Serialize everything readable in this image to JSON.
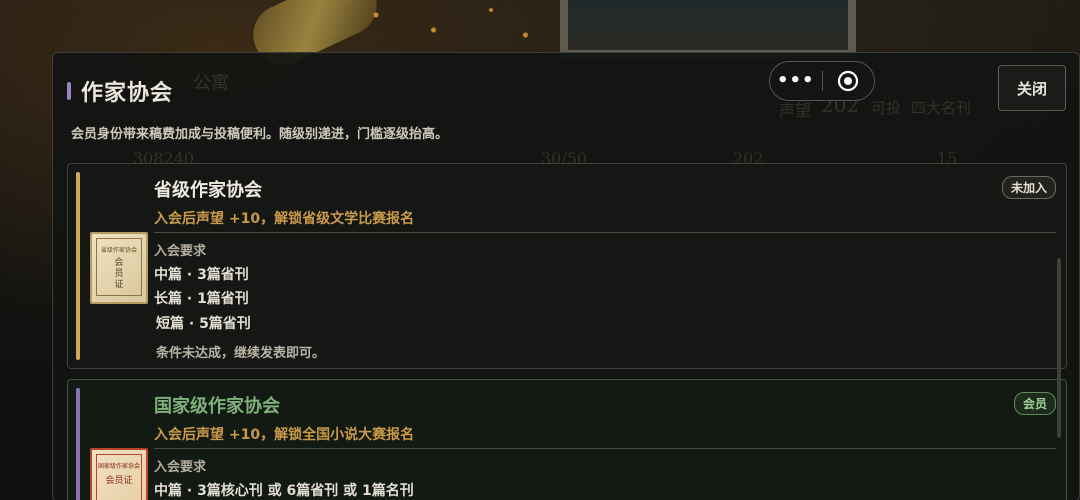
{
  "panel": {
    "title": "作家协会",
    "subtitle": "会员身份带来稿费加成与投稿便利。随级别递进，门槛逐级抬高。",
    "close_label": "关闭",
    "capsule_more": "•••"
  },
  "background_ghost": {
    "apt": "公寓",
    "reputation": "声望",
    "reputation_value": "202",
    "ghost_tag": "可投",
    "top_magazines": "四大名刊",
    "stat_a": "308240",
    "stat_b": "30/50",
    "stat_c": "202",
    "stat_d": "15"
  },
  "cards": [
    {
      "name": "省级作家协会",
      "benefit": "入会后声望 +10，解锁省级文学比赛报名",
      "req_label": "入会要求",
      "requirements": [
        "中篇 · 3篇省刊",
        "长篇 · 1篇省刊",
        "短篇 · 5篇省刊"
      ],
      "note": "条件未达成，继续发表即可。",
      "status": "未加入",
      "badge_text": "省级作家协会",
      "badge_main": "会员证",
      "accent": "#d2a75c"
    },
    {
      "name": "国家级作家协会",
      "benefit": "入会后声望 +10，解锁全国小说大赛报名",
      "req_label": "入会要求",
      "requirements": [
        "中篇 · 3篇核心刊 或 6篇省刊 或 1篇名刊"
      ],
      "status": "会员",
      "badge_text": "国家级作家协会",
      "badge_main": "会员证",
      "accent": "#8a73b4"
    }
  ],
  "colors": {
    "member_green": "#7fb07a",
    "gold": "#c99a49",
    "purple": "#9a86b8"
  }
}
